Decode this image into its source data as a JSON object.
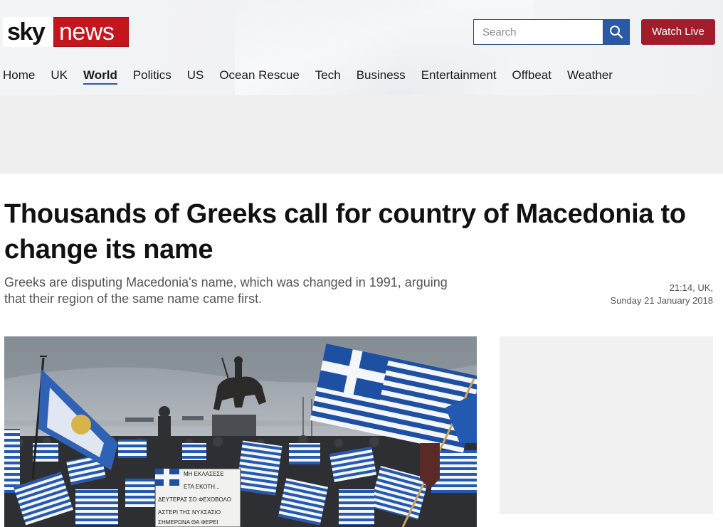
{
  "brand": {
    "sky": "sky",
    "news": "news",
    "accent": "#c4161c"
  },
  "search": {
    "placeholder": "Search",
    "icon": "search-icon"
  },
  "header": {
    "watch_live": "Watch Live",
    "watch_live_color": "#a11d2b"
  },
  "nav": {
    "items": [
      "Home",
      "UK",
      "World",
      "Politics",
      "US",
      "Ocean Rescue",
      "Tech",
      "Business",
      "Entertainment",
      "Offbeat",
      "Weather"
    ],
    "active": "World"
  },
  "article": {
    "headline": "Thousands of Greeks call for country of Macedonia to change its name",
    "standfirst": "Greeks are disputing Macedonia's name, which was changed in 1991, arguing that their region of the same name came first.",
    "time": "21:14, UK,",
    "date": "Sunday 21 January 2018"
  },
  "hero_image": {
    "banner_lines": [
      "ΜΗ ΕΚΛΑΣΕΣΕ",
      "ΕΤΑ ΕΚΟΤΗ...",
      "ΔΕΥΤΕΡΑΣ ΣΟ ΦΕΧΟΒΟΛΟ",
      "ΑΣΤΕΡΙ ΤΗΣ ΝΥΧΣΑΣΙΟ",
      "ΣΗΜΕΡΩΝΑ ΘΑ ΦΕΡΕΙ"
    ]
  }
}
